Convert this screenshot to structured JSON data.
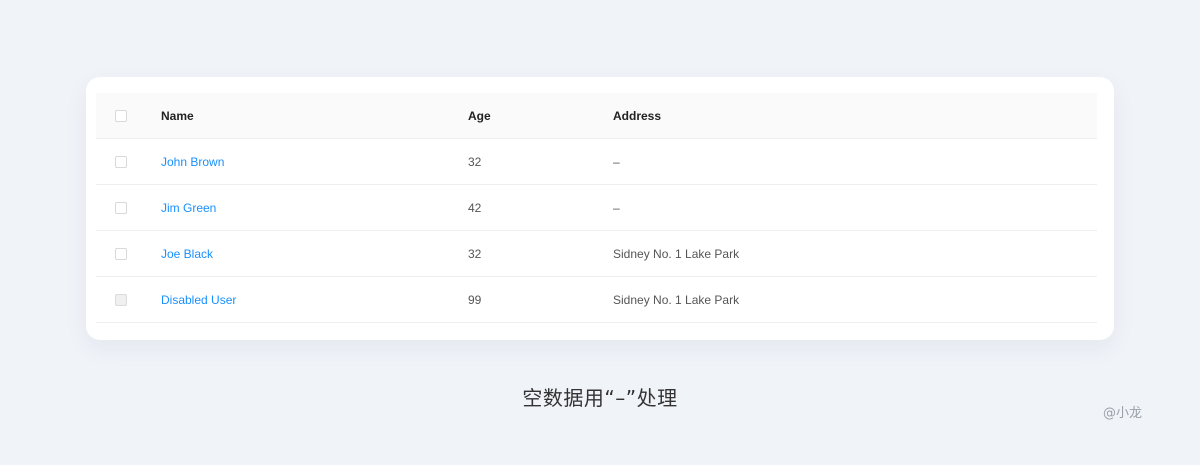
{
  "table": {
    "columns": {
      "name": "Name",
      "age": "Age",
      "address": "Address"
    },
    "rows": [
      {
        "name": "John Brown",
        "age": "32",
        "address": "–",
        "disabled": false
      },
      {
        "name": "Jim Green",
        "age": "42",
        "address": "–",
        "disabled": false
      },
      {
        "name": "Joe Black",
        "age": "32",
        "address": "Sidney No. 1 Lake Park",
        "disabled": false
      },
      {
        "name": "Disabled User",
        "age": "99",
        "address": "Sidney No. 1 Lake Park",
        "disabled": true
      }
    ]
  },
  "caption": "空数据用“–”处理",
  "watermark": "@小龙",
  "colors": {
    "page_bg": "#f0f3f8",
    "link": "#1890ff",
    "header_bg": "#fafafa"
  }
}
